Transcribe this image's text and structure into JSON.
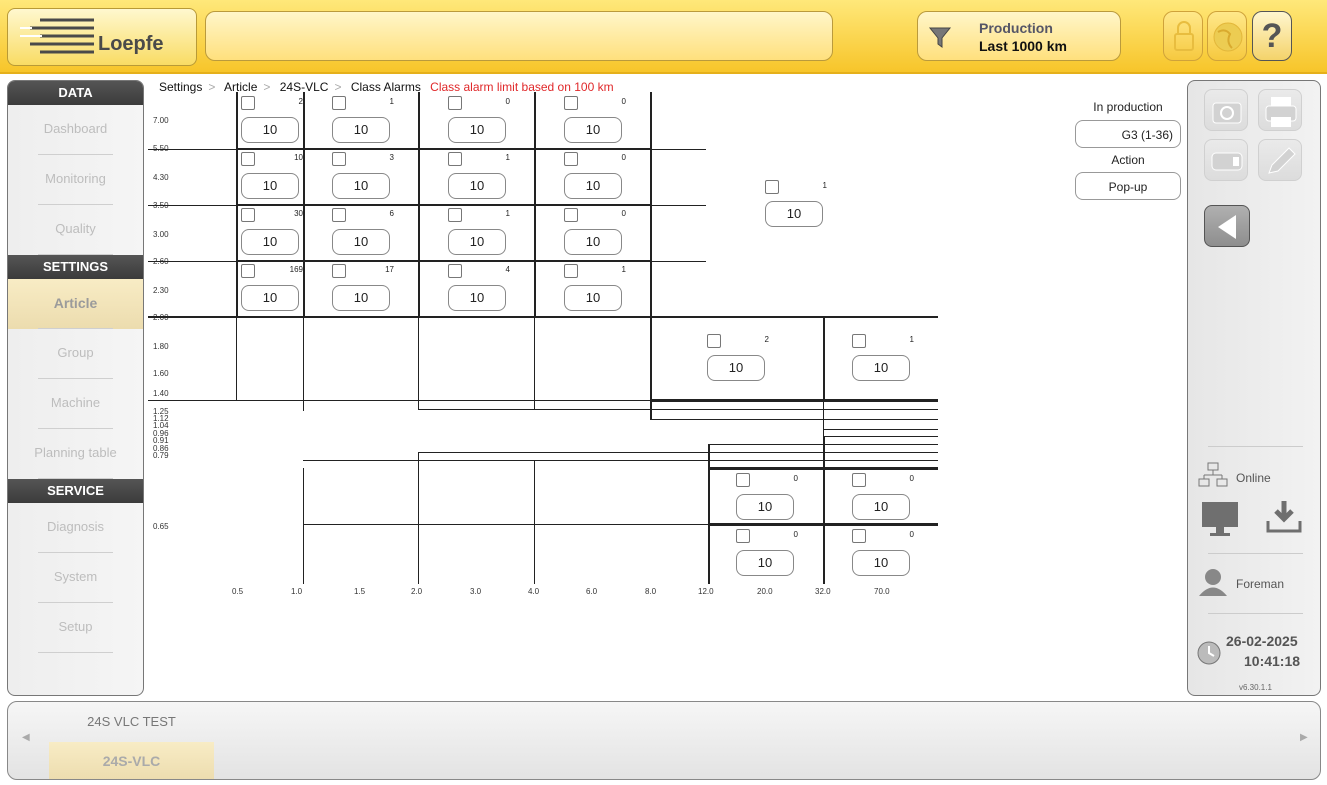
{
  "app": {
    "logo_text": "Loepfe"
  },
  "header": {
    "search_value": "",
    "production_label": "Production",
    "production_value": "Last 1000 km",
    "help_label": "?"
  },
  "sidebar": {
    "sections": [
      {
        "title": "DATA",
        "items": [
          "Dashboard",
          "Monitoring",
          "Quality"
        ]
      },
      {
        "title": "SETTINGS",
        "items": [
          "Article",
          "Group",
          "Machine",
          "Planning table"
        ]
      },
      {
        "title": "SERVICE",
        "items": [
          "Diagnosis",
          "System",
          "Setup"
        ]
      }
    ],
    "active_item": "Article"
  },
  "breadcrumb": {
    "items": [
      "Settings",
      "Article",
      "24S-VLC",
      "Class Alarms"
    ],
    "note": "Class alarm limit based on 100 km"
  },
  "panel": {
    "in_production_label": "In production",
    "in_production_value": "G3 (1-36)",
    "action_label": "Action",
    "action_value": "Pop-up"
  },
  "grid": {
    "y_labels": [
      "7.00",
      "5.50",
      "4.30",
      "3.50",
      "3.00",
      "2.60",
      "2.30",
      "2.00",
      "1.80",
      "1.60",
      "1.40",
      "1.25",
      "1.12",
      "1.04",
      "0.96",
      "0.91",
      "0.86",
      "0.79",
      "0.65"
    ],
    "x_labels": [
      "0.5",
      "1.0",
      "1.5",
      "2.0",
      "3.0",
      "4.0",
      "6.0",
      "8.0",
      "12.0",
      "20.0",
      "32.0",
      "70.0"
    ],
    "rows": [
      [
        {
          "count": "2",
          "value": "10"
        },
        {
          "count": "1",
          "value": "10"
        },
        {
          "count": "0",
          "value": "10"
        },
        {
          "count": "0",
          "value": "10"
        }
      ],
      [
        {
          "count": "10",
          "value": "10"
        },
        {
          "count": "3",
          "value": "10"
        },
        {
          "count": "1",
          "value": "10"
        },
        {
          "count": "0",
          "value": "10"
        }
      ],
      [
        {
          "count": "30",
          "value": "10"
        },
        {
          "count": "6",
          "value": "10"
        },
        {
          "count": "1",
          "value": "10"
        },
        {
          "count": "0",
          "value": "10"
        }
      ],
      [
        {
          "count": "169",
          "value": "10"
        },
        {
          "count": "17",
          "value": "10"
        },
        {
          "count": "4",
          "value": "10"
        },
        {
          "count": "1",
          "value": "10"
        }
      ]
    ],
    "side_cell": {
      "count": "1",
      "value": "10"
    },
    "mid_cells": [
      {
        "count": "2",
        "value": "10"
      },
      {
        "count": "1",
        "value": "10"
      }
    ],
    "low_cells": [
      [
        {
          "count": "0",
          "value": "10"
        },
        {
          "count": "0",
          "value": "10"
        }
      ],
      [
        {
          "count": "0",
          "value": "10"
        },
        {
          "count": "0",
          "value": "10"
        }
      ]
    ]
  },
  "status": {
    "online_label": "Online",
    "user_label": "Foreman",
    "date": "26-02-2025",
    "time": "10:41:18",
    "version": "v6.30.1.1"
  },
  "bottom_tabs": [
    "24S VLC TEST",
    "24S-VLC"
  ]
}
